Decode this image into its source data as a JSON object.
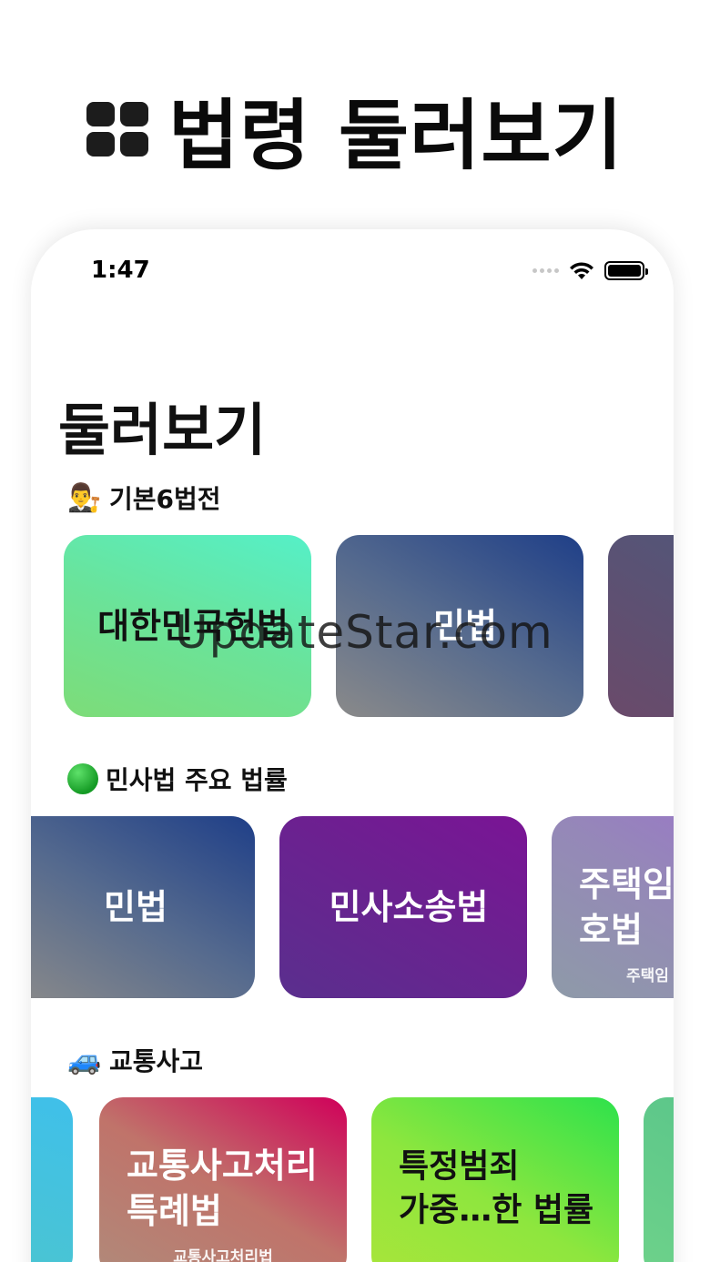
{
  "headline": {
    "text": "법령 둘러보기",
    "icon": "grid-icon"
  },
  "status_bar": {
    "time": "1:47",
    "icons": [
      "signal-dots-icon",
      "wifi-icon",
      "battery-icon"
    ]
  },
  "page_title": "둘러보기",
  "sections": [
    {
      "emoji": "👨‍⚖️",
      "label": "기본6법전",
      "cards": [
        {
          "title": "대한민국헌법",
          "subtitle": ""
        },
        {
          "title": "민법",
          "subtitle": ""
        },
        {
          "title": "",
          "subtitle": ""
        }
      ]
    },
    {
      "emoji": "green-circle",
      "label": "민사법 주요 법률",
      "cards": [
        {
          "title": "민법",
          "subtitle": ""
        },
        {
          "title": "민사소송법",
          "subtitle": ""
        },
        {
          "title": "주택임\n호법",
          "subtitle": "주택임"
        }
      ]
    },
    {
      "emoji": "🚙",
      "label": "교통사고",
      "cards": [
        {
          "title": "",
          "subtitle": ""
        },
        {
          "title": "교통사고처리\n특례법",
          "subtitle": "교통사고처리법"
        },
        {
          "title": "특정범죄\n가중…한 법률",
          "subtitle": ""
        },
        {
          "title": "",
          "subtitle": ""
        }
      ]
    }
  ],
  "watermark": "UpdateStar.com",
  "colors": {
    "headline_text": "#0a0a0a",
    "card_gradients": {
      "constitution": [
        "#7ddc78",
        "#55f0c8"
      ],
      "civil_law": [
        "#8a8a8a",
        "#1f3f88"
      ],
      "civil_procedure": [
        "#5a2f8e",
        "#7a1495"
      ],
      "housing": [
        "#8e9aa8",
        "#9b72cc"
      ],
      "traffic_special": [
        "#c0736a",
        "#d0005a"
      ],
      "specific_crimes": [
        "#8ee63e",
        "#2ee24c"
      ]
    }
  }
}
